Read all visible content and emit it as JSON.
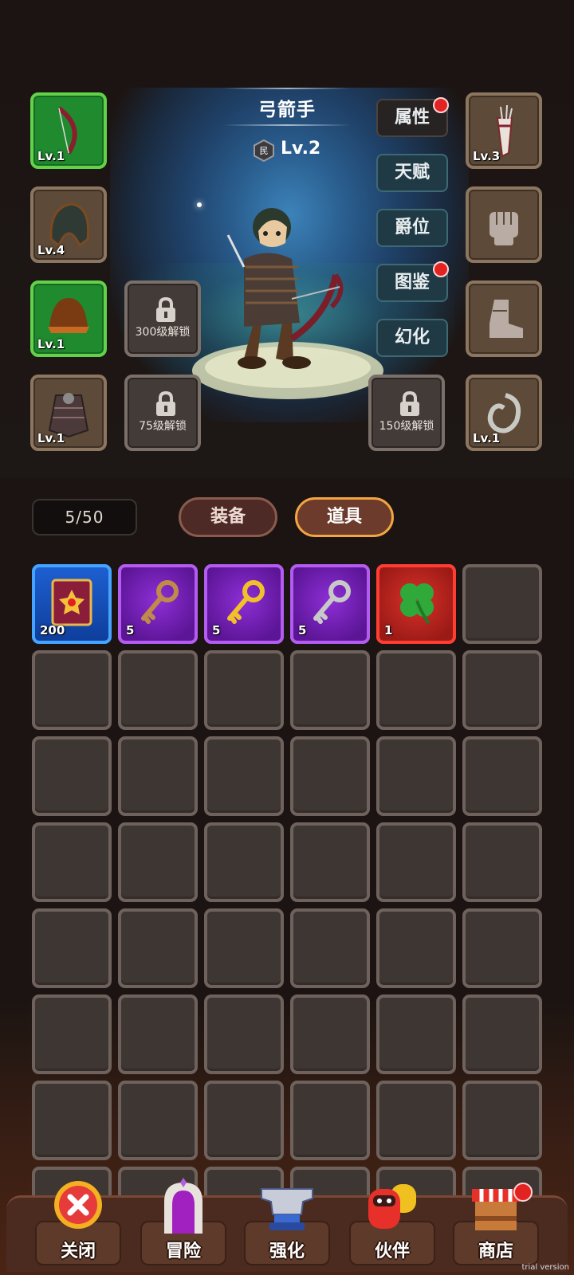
{
  "hero": {
    "name": "弓箭手",
    "rank_badge": "民",
    "level": "Lv.2"
  },
  "left_slots": [
    {
      "icon": "bow-icon",
      "level": "Lv.1",
      "rarity": "green"
    },
    {
      "icon": "hood-icon",
      "level": "Lv.4",
      "rarity": "brown"
    },
    {
      "icon": "helmet-icon",
      "level": "Lv.1",
      "rarity": "green"
    },
    {
      "icon": "armor-icon",
      "level": "Lv.1",
      "rarity": "brown"
    }
  ],
  "right_slots": [
    {
      "icon": "quiver-icon",
      "level": "Lv.3"
    },
    {
      "icon": "fist-icon",
      "level": ""
    },
    {
      "icon": "boot-icon",
      "level": ""
    },
    {
      "icon": "ring-icon",
      "level": "Lv.1"
    }
  ],
  "locked_slots": [
    {
      "text": "300级解锁"
    },
    {
      "text": "75级解锁"
    },
    {
      "text": "150级解锁"
    }
  ],
  "side_menu": [
    {
      "label": "属性",
      "notify": true
    },
    {
      "label": "天赋",
      "notify": false
    },
    {
      "label": "爵位",
      "notify": false
    },
    {
      "label": "图鉴",
      "notify": true
    },
    {
      "label": "幻化",
      "notify": false
    }
  ],
  "inventory": {
    "capacity": "5/50",
    "tabs": [
      {
        "label": "装备",
        "active": false
      },
      {
        "label": "道具",
        "active": true
      }
    ],
    "items": [
      {
        "icon": "spellbook-icon",
        "count": "200",
        "rarity": "blue"
      },
      {
        "icon": "bronze-key-icon",
        "count": "5",
        "rarity": "purple"
      },
      {
        "icon": "gold-key-icon",
        "count": "5",
        "rarity": "purple"
      },
      {
        "icon": "silver-key-icon",
        "count": "5",
        "rarity": "purple"
      },
      {
        "icon": "clover-icon",
        "count": "1",
        "rarity": "red"
      }
    ]
  },
  "bottom_nav": [
    {
      "label": "关闭",
      "icon": "close-icon",
      "notify": false
    },
    {
      "label": "冒险",
      "icon": "portal-icon",
      "notify": false
    },
    {
      "label": "强化",
      "icon": "anvil-icon",
      "notify": false
    },
    {
      "label": "伙伴",
      "icon": "partner-icon",
      "notify": false
    },
    {
      "label": "商店",
      "icon": "shop-icon",
      "notify": true
    }
  ],
  "watermark": "trial version",
  "colors": {
    "rarity_green": "#1f8a2e",
    "rarity_blue": "#1d5fd0",
    "rarity_purple": "#8d2fd6",
    "rarity_red": "#d8322a",
    "tab_active_border": "#f2a640",
    "notify_dot": "#e32222"
  }
}
